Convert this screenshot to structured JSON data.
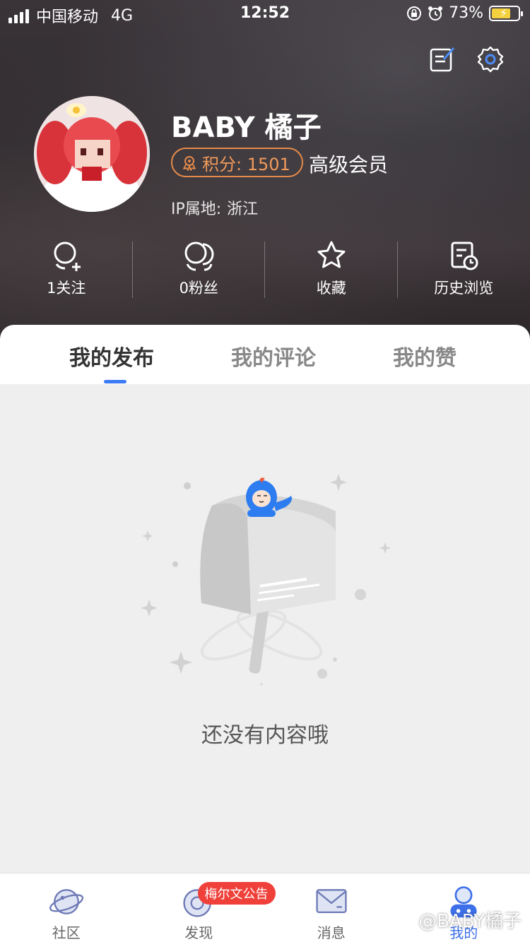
{
  "status_bar": {
    "carrier": "中国移动",
    "network": "4G",
    "time": "12:52",
    "battery": "73%"
  },
  "profile": {
    "username": "BABY 橘子",
    "points_label": "积分: 1501",
    "member_level": "高级会员",
    "ip_label": "IP属地:",
    "ip_value": "浙江"
  },
  "stats": [
    {
      "label": "1关注",
      "icon": "follow-icon"
    },
    {
      "label": "0粉丝",
      "icon": "fans-icon"
    },
    {
      "label": "收藏",
      "icon": "star-icon"
    },
    {
      "label": "历史浏览",
      "icon": "history-icon"
    }
  ],
  "tabs": [
    {
      "label": "我的发布",
      "active": true
    },
    {
      "label": "我的评论",
      "active": false
    },
    {
      "label": "我的赞",
      "active": false
    }
  ],
  "empty_state": {
    "text": "还没有内容哦"
  },
  "bottom_nav": [
    {
      "label": "社区",
      "icon": "planet-icon"
    },
    {
      "label": "发现",
      "icon": "discover-icon",
      "badge": "梅尔文公告"
    },
    {
      "label": "消息",
      "icon": "mail-icon"
    },
    {
      "label": "我的",
      "icon": "user-icon",
      "active": true
    }
  ],
  "watermark": "@BABY橘子",
  "colors": {
    "accent": "#3d7af5",
    "points": "#e58a4a",
    "badge": "#f0403a"
  }
}
